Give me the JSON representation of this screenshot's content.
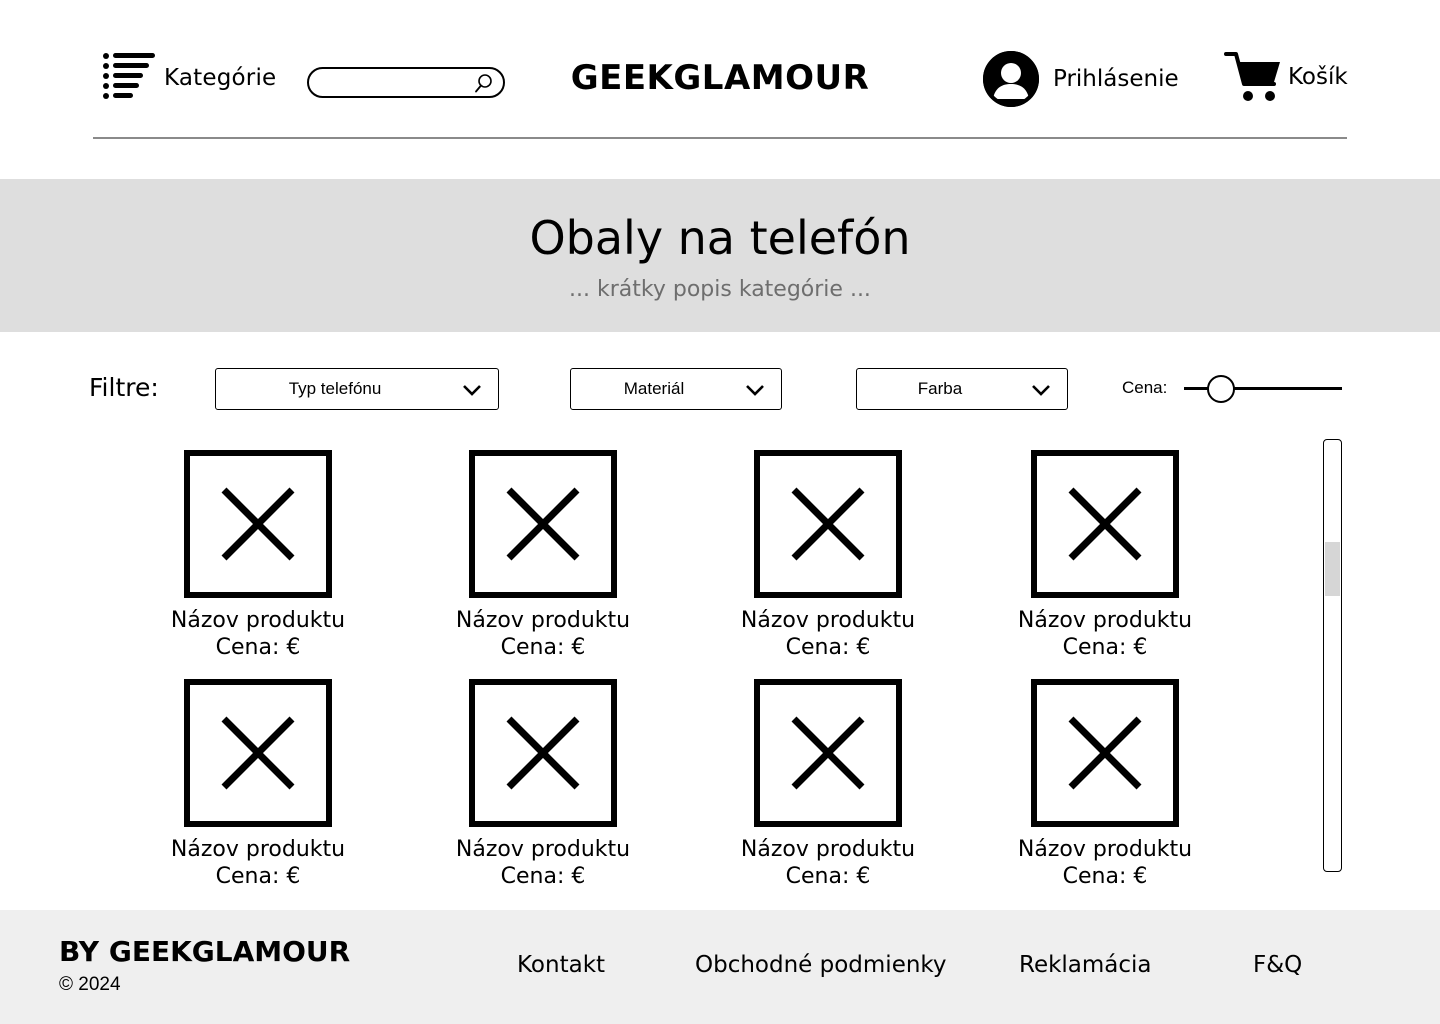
{
  "header": {
    "categories_label": "Kategórie",
    "search_placeholder": "",
    "logo": "GEEKGLAMOUR",
    "login_label": "Prihlásenie",
    "cart_label": "Košík"
  },
  "banner": {
    "title": "Obaly na telefón",
    "subtitle": "... krátky popis kategórie ..."
  },
  "filters": {
    "label": "Filtre:",
    "selects": [
      "Typ telefónu",
      "Materiál",
      "Farba"
    ],
    "price_label": "Cena:",
    "price_slider_value": 0.18
  },
  "products": [
    {
      "name": "Názov produktu",
      "price": "Cena: €"
    },
    {
      "name": "Názov produktu",
      "price": "Cena: €"
    },
    {
      "name": "Názov produktu",
      "price": "Cena: €"
    },
    {
      "name": "Názov produktu",
      "price": "Cena: €"
    },
    {
      "name": "Názov produktu",
      "price": "Cena: €"
    },
    {
      "name": "Názov produktu",
      "price": "Cena: €"
    },
    {
      "name": "Názov produktu",
      "price": "Cena: €"
    },
    {
      "name": "Názov produktu",
      "price": "Cena: €"
    }
  ],
  "scrollbar": {
    "position": 0.27
  },
  "footer": {
    "brand": "BY GEEKGLAMOUR",
    "copyright": "© 2024",
    "links": [
      "Kontakt",
      "Obchodné podmienky",
      "Reklamácia",
      "F&Q"
    ]
  }
}
